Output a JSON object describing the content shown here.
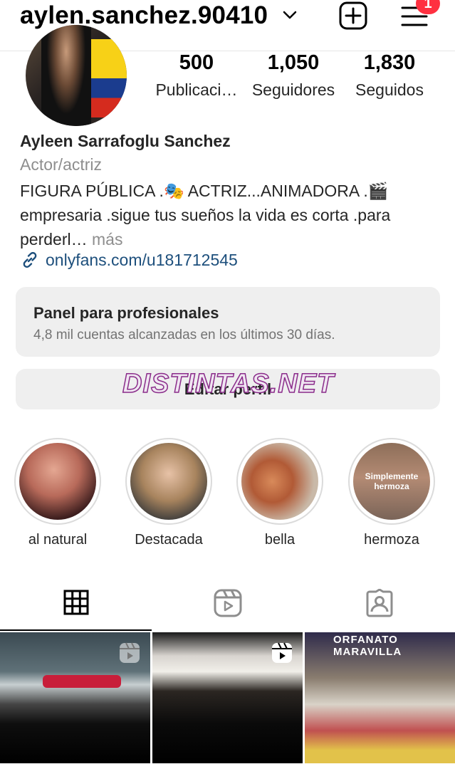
{
  "header": {
    "username": "aylen.sanchez.90410",
    "notification_count": "1"
  },
  "profile": {
    "stats": [
      {
        "value": "500",
        "label": "Publicaci…"
      },
      {
        "value": "1,050",
        "label": "Seguidores"
      },
      {
        "value": "1,830",
        "label": "Seguidos"
      }
    ],
    "name": "Ayleen Sarrafoglu Sanchez",
    "category": "Actor/actriz",
    "bio_line1": "FIGURA PÚBLICA .🎭  ACTRIZ...ANIMADORA .🎬",
    "bio_line2": "empresaria .sigue tus sueños la vida es corta .para",
    "bio_line3": "perderl…",
    "bio_more": " más",
    "link": "onlyfans.com/u181712545"
  },
  "panel": {
    "title": "Panel para profesionales",
    "subtitle": "4,8 mil cuentas alcanzadas en los últimos 30 días."
  },
  "edit_button": "Editar perfil",
  "watermark": "DISTINTAS.NET",
  "highlights": [
    {
      "label": "al natural"
    },
    {
      "label": "Destacada"
    },
    {
      "label": "bella"
    },
    {
      "label": "hermoza",
      "image_text": "Simplemente hermoza"
    }
  ],
  "grid_text": {
    "post3_sign": "ORFANATO MARAVILLA"
  },
  "colors": {
    "link": "#1d4f7c",
    "badge": "#ff3040",
    "panel_bg": "#efefef"
  }
}
